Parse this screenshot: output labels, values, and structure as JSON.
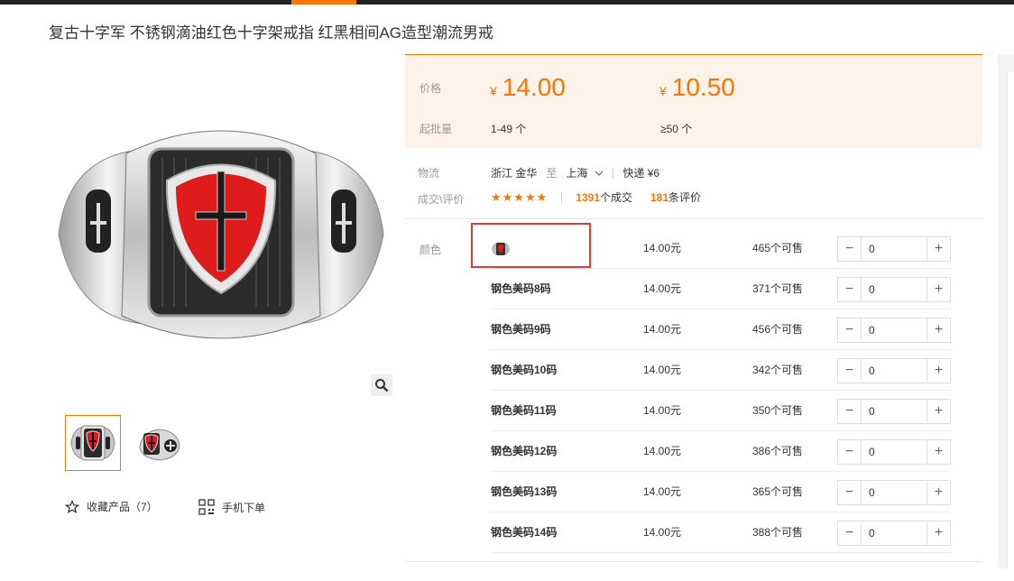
{
  "title": "复古十字军 不锈钢滴油红色十字架戒指 红黑相间AG造型潮流男戒",
  "price_box": {
    "price_label": "价格",
    "prices": [
      {
        "currency": "¥",
        "value": "14.00",
        "qty": "1-49 个"
      },
      {
        "currency": "¥",
        "value": "10.50",
        "qty": "≥50 个"
      }
    ],
    "qty_label": "起批量"
  },
  "logistics": {
    "label": "物流",
    "from": "浙江 金华",
    "to_word": "至",
    "to": "上海",
    "express": "快递 ¥6"
  },
  "trade": {
    "label": "成交\\评价",
    "stars": "★★★★★",
    "deals_count": "1391",
    "deals_text": "个成交",
    "reviews_count": "181",
    "reviews_text": "条评价"
  },
  "sku": {
    "label": "颜色",
    "rows": [
      {
        "name": "",
        "price": "14.00元",
        "stock": "465个可售",
        "qty": "0",
        "image": true
      },
      {
        "name": "钢色美码8码",
        "price": "14.00元",
        "stock": "371个可售",
        "qty": "0"
      },
      {
        "name": "钢色美码9码",
        "price": "14.00元",
        "stock": "456个可售",
        "qty": "0"
      },
      {
        "name": "钢色美码10码",
        "price": "14.00元",
        "stock": "342个可售",
        "qty": "0"
      },
      {
        "name": "钢色美码11码",
        "price": "14.00元",
        "stock": "350个可售",
        "qty": "0"
      },
      {
        "name": "钢色美码12码",
        "price": "14.00元",
        "stock": "386个可售",
        "qty": "0"
      },
      {
        "name": "钢色美码13码",
        "price": "14.00元",
        "stock": "365个可售",
        "qty": "0"
      },
      {
        "name": "钢色美码14码",
        "price": "14.00元",
        "stock": "388个可售",
        "qty": "0"
      }
    ]
  },
  "actions": {
    "favorite": "收藏产品（7）",
    "mobile_order": "手机下单"
  },
  "colors": {
    "accent": "#ff7300",
    "highlight_box": "#e53935"
  }
}
